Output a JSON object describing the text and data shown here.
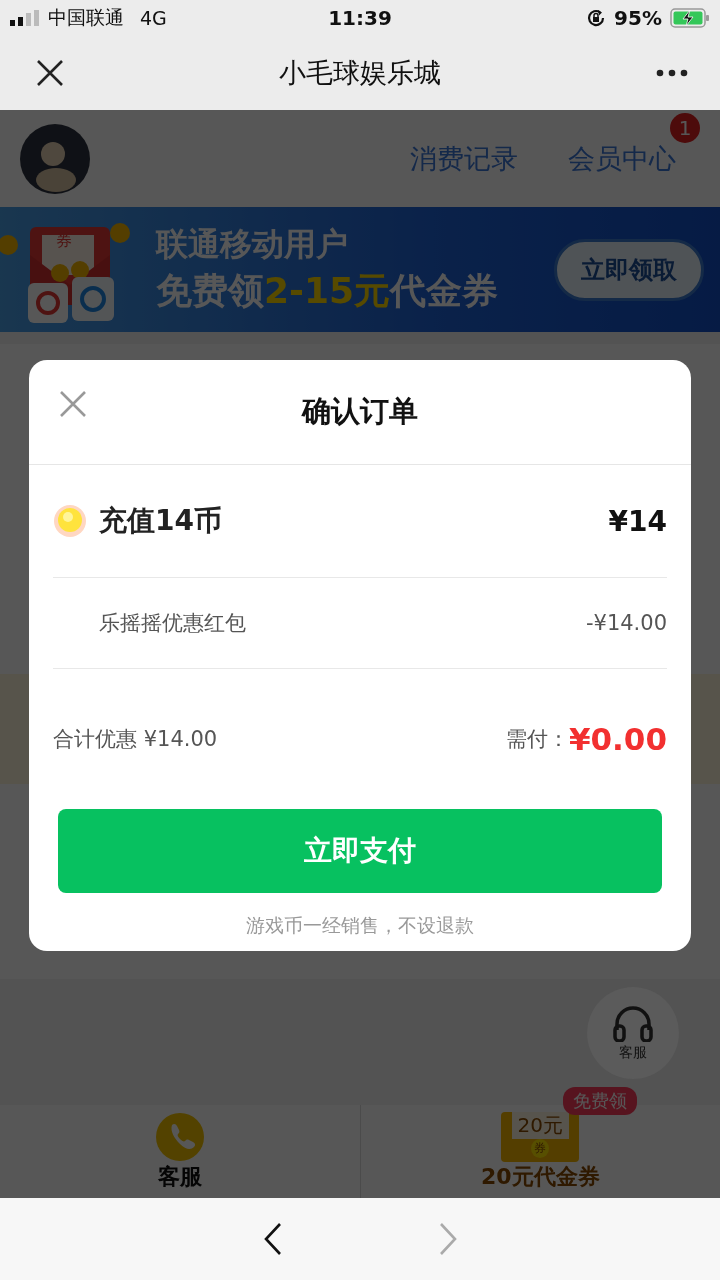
{
  "status_bar": {
    "carrier": "中国联通",
    "network": "4G",
    "time": "11:39",
    "battery": "95%"
  },
  "nav": {
    "title": "小毛球娱乐城"
  },
  "header": {
    "links": [
      {
        "label": "消费记录"
      },
      {
        "label": "会员中心",
        "badge": "1"
      }
    ]
  },
  "banner": {
    "line_1": "联通移动用户",
    "line_2_prefix": "免费领",
    "line_2_amount": "2-15元",
    "line_2_suffix": "代金券",
    "button": "立即领取",
    "coupon_mark": "券"
  },
  "dialog": {
    "title": "确认订单",
    "item": {
      "name": "充值14币",
      "price": "¥14"
    },
    "discount": {
      "name": "乐摇摇优惠红包",
      "amount": "-¥14.00"
    },
    "total_discount": "合计优惠 ¥14.00",
    "due_label": "需付：",
    "due_amount": "¥0.00",
    "pay_button": "立即支付",
    "note": "游戏币一经销售，不设退款"
  },
  "float_button": {
    "label": "客服"
  },
  "bottom_bar": [
    {
      "kind": "phone",
      "label": "客服"
    },
    {
      "kind": "coupon",
      "label": "20元代金券",
      "badge": "免费领",
      "coupon_amount": "20元",
      "coupon_mark": "券"
    }
  ],
  "browser_bar": {
    "back_disabled": false,
    "forward_disabled": true
  }
}
